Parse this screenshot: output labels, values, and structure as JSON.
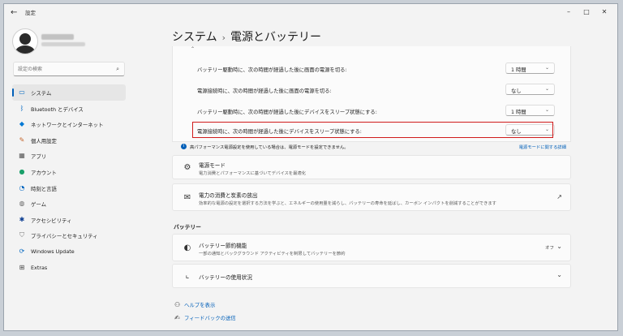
{
  "window": {
    "title": "設定"
  },
  "search": {
    "placeholder": "設定の検索"
  },
  "nav": [
    {
      "label": "システム",
      "icon": "monitor-icon",
      "active": true
    },
    {
      "label": "Bluetooth とデバイス",
      "icon": "bluetooth-icon"
    },
    {
      "label": "ネットワークとインターネット",
      "icon": "wifi-icon"
    },
    {
      "label": "個人用設定",
      "icon": "brush-icon"
    },
    {
      "label": "アプリ",
      "icon": "apps-icon"
    },
    {
      "label": "アカウント",
      "icon": "account-icon"
    },
    {
      "label": "時刻と言語",
      "icon": "clock-globe-icon"
    },
    {
      "label": "ゲーム",
      "icon": "gamepad-icon"
    },
    {
      "label": "アクセシビリティ",
      "icon": "accessibility-icon"
    },
    {
      "label": "プライバシーとセキュリティ",
      "icon": "shield-icon"
    },
    {
      "label": "Windows Update",
      "icon": "update-icon"
    },
    {
      "label": "Extras",
      "icon": "extras-icon"
    }
  ],
  "breadcrumb": {
    "parent": "システム",
    "separator": "›",
    "current": "電源とバッテリー"
  },
  "screen_sleep": {
    "rows": [
      {
        "label": "バッテリー駆動時に、次の時間が経過した後に画面の電源を切る:",
        "value": "1 時間"
      },
      {
        "label": "電源接続時に、次の時間が経過した後に画面の電源を切る:",
        "value": "なし"
      },
      {
        "label": "バッテリー駆動時に、次の時間が経過した後にデバイスをスリープ状態にする:",
        "value": "1 時間"
      },
      {
        "label": "電源接続時に、次の時間が経過した後にデバイスをスリープ状態にする:",
        "value": "なし"
      }
    ]
  },
  "info": {
    "text": "高パフォーマンス電源設定を使用している場合は、電源モードを設定できません。",
    "link": "電源モードに関する詳細"
  },
  "power_mode": {
    "title": "電源モード",
    "desc": "電力消費とパフォーマンスに基づいてデバイスを最適化"
  },
  "energy": {
    "title": "電力の消費と炭素の放出",
    "desc": "効率的な電源の設定を選択する方法を学ぶと、エネルギーの使用量を減らし、バッテリーの寿命を延ばし、カーボン インパクトを削減することができます"
  },
  "battery_section": {
    "heading": "バッテリー"
  },
  "battery_saver": {
    "title": "バッテリー節約機能",
    "desc": "一部の通知とバックグラウンド アクティビティを制限してバッテリーを節約",
    "state": "オフ"
  },
  "battery_usage": {
    "title": "バッテリーの使用状況"
  },
  "links": {
    "help": "ヘルプを表示",
    "feedback": "フィードバックの送信"
  },
  "colors": {
    "accent": "#005fb8",
    "highlight": "#d01b1b"
  }
}
